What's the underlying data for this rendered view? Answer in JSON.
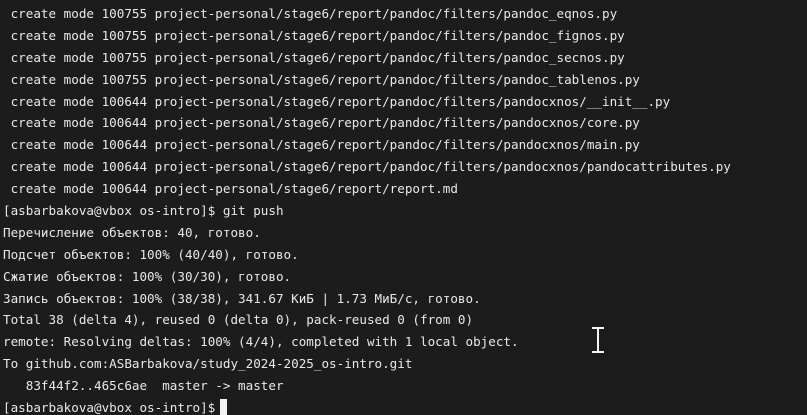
{
  "terminal": {
    "lines": [
      " create mode 100755 project-personal/stage6/report/pandoc/filters/pandoc_eqnos.py",
      " create mode 100755 project-personal/stage6/report/pandoc/filters/pandoc_fignos.py",
      " create mode 100755 project-personal/stage6/report/pandoc/filters/pandoc_secnos.py",
      " create mode 100755 project-personal/stage6/report/pandoc/filters/pandoc_tablenos.py",
      " create mode 100644 project-personal/stage6/report/pandoc/filters/pandocxnos/__init__.py",
      " create mode 100644 project-personal/stage6/report/pandoc/filters/pandocxnos/core.py",
      " create mode 100644 project-personal/stage6/report/pandoc/filters/pandocxnos/main.py",
      " create mode 100644 project-personal/stage6/report/pandoc/filters/pandocxnos/pandocattributes.py",
      " create mode 100644 project-personal/stage6/report/report.md",
      "[asbarbakova@vbox os-intro]$ git push",
      "Перечисление объектов: 40, готово.",
      "Подсчет объектов: 100% (40/40), готово.",
      "Сжатие объектов: 100% (30/30), готово.",
      "Запись объектов: 100% (38/38), 341.67 КиБ | 1.73 МиБ/с, готово.",
      "Total 38 (delta 4), reused 0 (delta 0), pack-reused 0 (from 0)",
      "remote: Resolving deltas: 100% (4/4), completed with 1 local object.",
      "To github.com:ASBarbakova/study_2024-2025_os-intro.git",
      "   83f44f2..465c6ae  master -> master"
    ],
    "prompt": "[asbarbakova@vbox os-intro]$"
  }
}
